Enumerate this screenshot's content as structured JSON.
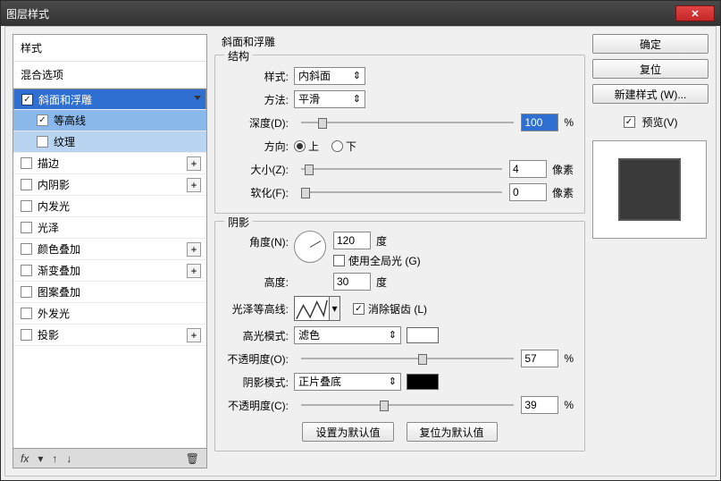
{
  "window": {
    "title": "图层样式"
  },
  "sidebar": {
    "header1": "样式",
    "header2": "混合选项",
    "items": [
      {
        "label": "斜面和浮雕",
        "checked": true,
        "selected": true,
        "plus": false,
        "indent": 0
      },
      {
        "label": "等高线",
        "checked": true,
        "selected": false,
        "plus": false,
        "indent": 1
      },
      {
        "label": "纹理",
        "checked": false,
        "selected": false,
        "plus": false,
        "indent": 2
      },
      {
        "label": "描边",
        "checked": false,
        "plus": true
      },
      {
        "label": "内阴影",
        "checked": false,
        "plus": true
      },
      {
        "label": "内发光",
        "checked": false,
        "plus": false
      },
      {
        "label": "光泽",
        "checked": false,
        "plus": false
      },
      {
        "label": "颜色叠加",
        "checked": false,
        "plus": true
      },
      {
        "label": "渐变叠加",
        "checked": false,
        "plus": true
      },
      {
        "label": "图案叠加",
        "checked": false,
        "plus": false
      },
      {
        "label": "外发光",
        "checked": false,
        "plus": false
      },
      {
        "label": "投影",
        "checked": false,
        "plus": true
      }
    ],
    "footer_fx": "fx"
  },
  "panel": {
    "title": "斜面和浮雕",
    "structure": {
      "legend": "结构",
      "style_label": "样式:",
      "style_value": "内斜面",
      "method_label": "方法:",
      "method_value": "平滑",
      "depth_label": "深度(D):",
      "depth_value": "100",
      "depth_unit": "%",
      "direction_label": "方向:",
      "dir_up": "上",
      "dir_down": "下",
      "size_label": "大小(Z):",
      "size_value": "4",
      "size_unit": "像素",
      "soften_label": "软化(F):",
      "soften_value": "0",
      "soften_unit": "像素"
    },
    "shading": {
      "legend": "阴影",
      "angle_label": "角度(N):",
      "angle_value": "120",
      "angle_unit": "度",
      "global_light_label": "使用全局光 (G)",
      "altitude_label": "高度:",
      "altitude_value": "30",
      "altitude_unit": "度",
      "gloss_label": "光泽等高线:",
      "antialias_label": "消除锯齿 (L)",
      "hmode_label": "高光模式:",
      "hmode_value": "滤色",
      "hopacity_label": "不透明度(O):",
      "hopacity_value": "57",
      "hopacity_unit": "%",
      "smode_label": "阴影模式:",
      "smode_value": "正片叠底",
      "sopacity_label": "不透明度(C):",
      "sopacity_value": "39",
      "sopacity_unit": "%",
      "hcolor": "#ffffff",
      "scolor": "#000000"
    },
    "buttons": {
      "make_default": "设置为默认值",
      "reset_default": "复位为默认值"
    }
  },
  "right": {
    "ok": "确定",
    "cancel": "复位",
    "new_style": "新建样式 (W)...",
    "preview_label": "预览(V)"
  }
}
